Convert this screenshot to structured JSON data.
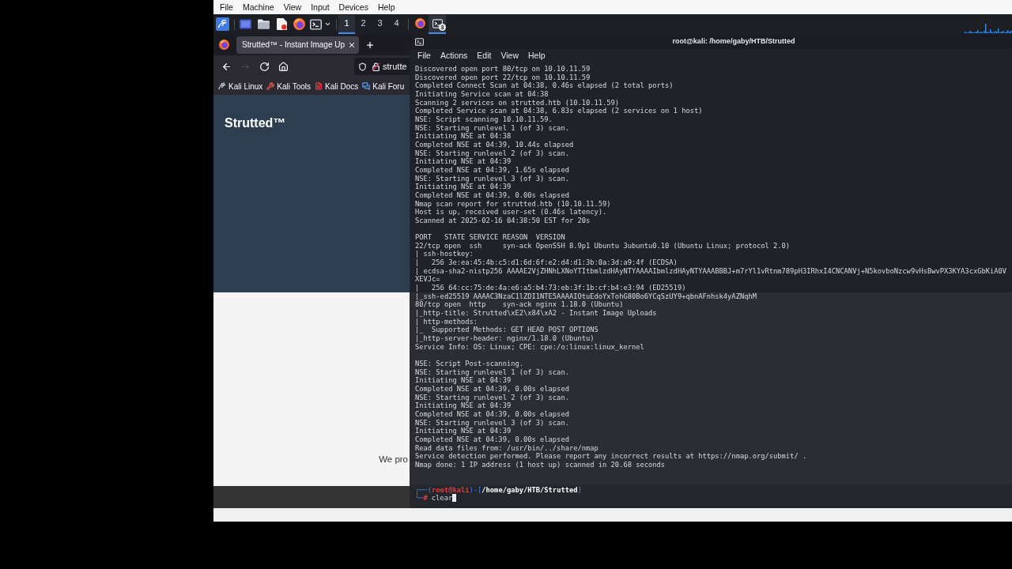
{
  "vm_menu": [
    "File",
    "Machine",
    "View",
    "Input",
    "Devices",
    "Help"
  ],
  "taskbar": {
    "workspaces": [
      {
        "label": "1",
        "selected": true
      },
      {
        "label": "2",
        "selected": false
      },
      {
        "label": "3",
        "selected": false
      },
      {
        "label": "4",
        "selected": false
      }
    ],
    "windows": [
      {
        "kind": "browser",
        "active": false
      },
      {
        "kind": "terminal",
        "active": true,
        "badge": "3"
      }
    ]
  },
  "browser": {
    "tabs": [
      {
        "title": "Strutted™ - Instant Image Up",
        "selected": true
      }
    ],
    "nav": [
      {
        "kind": "back",
        "disabled": false
      },
      {
        "kind": "forward",
        "disabled": true
      },
      {
        "kind": "reload",
        "disabled": false
      },
      {
        "kind": "home",
        "disabled": false
      }
    ],
    "url": "strutte",
    "bookmarks": [
      {
        "kind": "linux",
        "label": "Kali Linux"
      },
      {
        "kind": "tools",
        "label": "Kali Tools"
      },
      {
        "kind": "docs",
        "label": "Kali Docs"
      },
      {
        "kind": "forum",
        "label": "Kali Foru"
      }
    ],
    "page": {
      "site_title": "Strutted™",
      "intro": "We pro"
    }
  },
  "terminal": {
    "title": "root@kali: /home/gaby/HTB/Strutted",
    "menu": [
      "File",
      "Actions",
      "Edit",
      "View",
      "Help"
    ],
    "blocks": [
      [
        "Discovered open port 80/tcp on 10.10.11.59",
        "Discovered open port 22/tcp on 10.10.11.59",
        "Completed Connect Scan at 04:38, 0.46s elapsed (2 total ports)",
        "Initiating Service scan at 04:38",
        "Scanning 2 services on strutted.htb (10.10.11.59)",
        "Completed Service scan at 04:38, 6.83s elapsed (2 services on 1 host)",
        "NSE: Script scanning 10.10.11.59.",
        "NSE: Starting runlevel 1 (of 3) scan.",
        "Initiating NSE at 04:38",
        "Completed NSE at 04:39, 10.44s elapsed",
        "NSE: Starting runlevel 2 (of 3) scan.",
        "Initiating NSE at 04:39",
        "Completed NSE at 04:39, 1.65s elapsed",
        "NSE: Starting runlevel 3 (of 3) scan.",
        "Initiating NSE at 04:39",
        "Completed NSE at 04:39, 0.00s elapsed",
        "Nmap scan report for strutted.htb (10.10.11.59)",
        "Host is up, received user-set (0.46s latency).",
        "Scanned at 2025-02-16 04:38:50 EST for 20s"
      ],
      [
        "PORT   STATE SERVICE REASON  VERSION",
        "22/tcp open  ssh     syn-ack OpenSSH 8.9p1 Ubuntu 3ubuntu0.10 (Ubuntu Linux; protocol 2.0)",
        "| ssh-hostkey:",
        "|   256 3e:ea:45:4b:c5:d1:6d:6f:e2:d4:d1:3b:0a:3d:a9:4f (ECDSA)",
        "| ecdsa-sha2-nistp256 AAAAE2VjZHNhLXNoYTItbmlzdHAyNTYAAAAIbmlzdHAyNTYAAABBBJ+m7rYl1vRtnm789pH3IRhxI4CNCANVj+N5kovboNzcw9vHsBwvPX3KYA3cxGbKiA0V",
        "XEVJc=",
        "|   256 64:cc:75:de:4a:e6:a5:b4:73:eb:3f:1b:cf:b4:e3:94 (ED25519)",
        "|_ssh-ed25519 AAAAC3NzaC1lZDI1NTE5AAAAIOtuEdoYxTohG80Bo6YCqSzUY9+qbnAFnhsk4yAZNqhM",
        "80/tcp open  http    syn-ack nginx 1.18.0 (Ubuntu)",
        "|_http-title: Strutted\\xE2\\x84\\xA2 - Instant Image Uploads",
        "| http-methods:",
        "|_  Supported Methods: GET HEAD POST OPTIONS",
        "|_http-server-header: nginx/1.18.0 (Ubuntu)",
        "Service Info: OS: Linux; CPE: cpe:/o:linux:linux_kernel"
      ],
      [
        "NSE: Script Post-scanning.",
        "NSE: Starting runlevel 1 (of 3) scan.",
        "Initiating NSE at 04:39",
        "Completed NSE at 04:39, 0.00s elapsed",
        "NSE: Starting runlevel 2 (of 3) scan.",
        "Initiating NSE at 04:39",
        "Completed NSE at 04:39, 0.00s elapsed",
        "NSE: Starting runlevel 3 (of 3) scan.",
        "Initiating NSE at 04:39",
        "Completed NSE at 04:39, 0.00s elapsed",
        "Read data files from: /usr/bin/../share/nmap",
        "Service detection performed. Please report any incorrect results at https://nmap.org/submit/ .",
        "Nmap done: 1 IP address (1 host up) scanned in 20.68 seconds"
      ]
    ],
    "prompt": {
      "open": "┌──(",
      "user": "root@kali",
      "sep": ")-[",
      "path": "/home/gaby/HTB/Strutted",
      "close": "]",
      "corner": "└─",
      "symbol": "#",
      "command": "clear"
    }
  }
}
